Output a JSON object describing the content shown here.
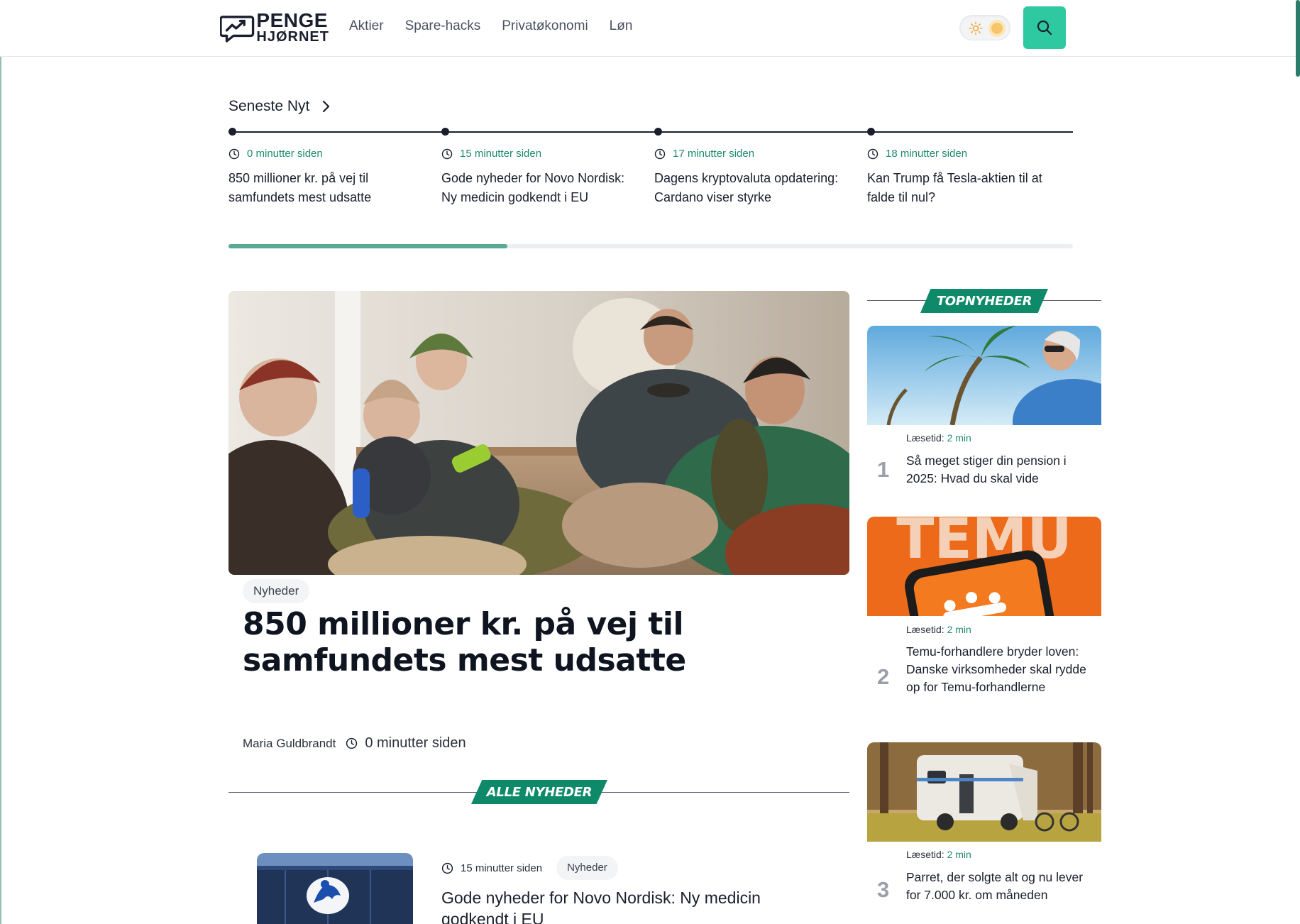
{
  "header": {
    "logo_line1": "PENGE",
    "logo_line2": "HJØRNET",
    "nav": [
      "Aktier",
      "Spare-hacks",
      "Privatøkonomi",
      "Løn"
    ],
    "colors": {
      "accent": "#2ec9a0",
      "brand_green": "#0e8a6a",
      "time_green": "#1f8a6e"
    }
  },
  "latest": {
    "title": "Seneste Nyt",
    "progress": 0.33,
    "items": [
      {
        "time": "0 minutter siden",
        "headline": "850 millioner kr. på vej til samfundets mest udsatte"
      },
      {
        "time": "15 minutter siden",
        "headline": "Gode nyheder for Novo Nordisk: Ny medicin godkendt i EU"
      },
      {
        "time": "17 minutter siden",
        "headline": "Dagens kryptovaluta opdatering: Cardano viser styrke"
      },
      {
        "time": "18 minutter siden",
        "headline": "Kan Trump få Tesla-aktien til at falde til nul?"
      }
    ]
  },
  "hero": {
    "category": "Nyheder",
    "title": "850 millioner kr. på vej til samfundets mest udsatte",
    "author": "Maria Guldbrandt",
    "time": "0 minutter siden"
  },
  "all_news": {
    "heading": "ALLE NYHEDER",
    "items": [
      {
        "time": "15 minutter siden",
        "category": "Nyheder",
        "title": "Gode nyheder for Novo Nordisk: Ny medicin godkendt i EU"
      }
    ]
  },
  "top_news": {
    "heading": "TOPNYHEDER",
    "read_label": "Læsetid:",
    "items": [
      {
        "rank": "1",
        "read_time": "2 min",
        "title": "Så meget stiger din pension i 2025: Hvad du skal vide"
      },
      {
        "rank": "2",
        "read_time": "2 min",
        "title": "Temu-forhandlere bryder loven: Danske virksomheder skal rydde op for Temu-forhandlerne"
      },
      {
        "rank": "3",
        "read_time": "2 min",
        "title": "Parret, der solgte alt og nu lever for 7.000 kr. om måneden"
      }
    ]
  },
  "image_overlays": {
    "temu_logo": "TEMU"
  }
}
